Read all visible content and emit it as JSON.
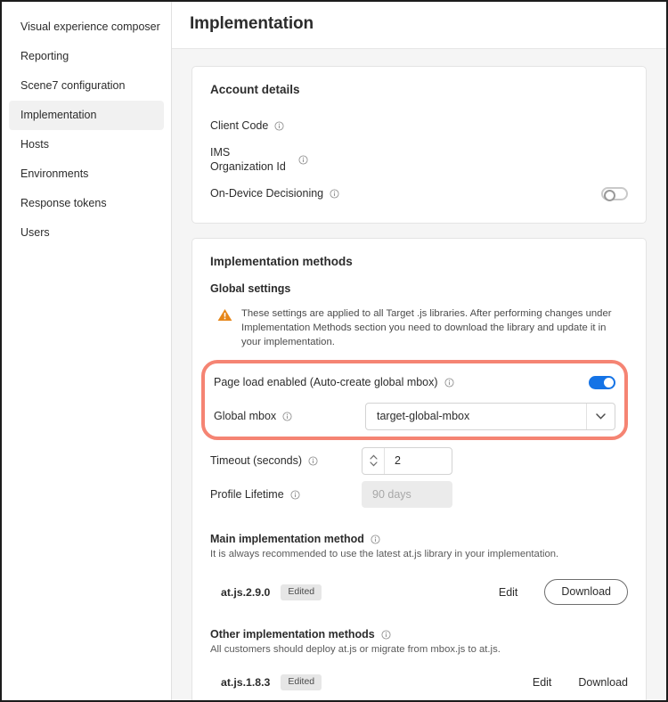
{
  "sidebar": {
    "items": [
      {
        "label": "Visual experience composer",
        "active": false
      },
      {
        "label": "Reporting",
        "active": false
      },
      {
        "label": "Scene7 configuration",
        "active": false
      },
      {
        "label": "Implementation",
        "active": true
      },
      {
        "label": "Hosts",
        "active": false
      },
      {
        "label": "Environments",
        "active": false
      },
      {
        "label": "Response tokens",
        "active": false
      },
      {
        "label": "Users",
        "active": false
      }
    ]
  },
  "header": {
    "title": "Implementation"
  },
  "account_details": {
    "title": "Account details",
    "client_code_label": "Client Code",
    "ims_org_label": "IMS Organization Id",
    "on_device_label": "On-Device Decisioning",
    "on_device_state": "off"
  },
  "implementation_methods": {
    "title": "Implementation methods",
    "global_settings_title": "Global settings",
    "warning_text": "These settings are applied to all Target .js libraries. After performing changes under Implementation Methods section you need to download the library and update it in your implementation.",
    "page_load_label": "Page load enabled (Auto-create global mbox)",
    "page_load_state": "on",
    "global_mbox_label": "Global mbox",
    "global_mbox_value": "target-global-mbox",
    "timeout_label": "Timeout (seconds)",
    "timeout_value": "2",
    "profile_lifetime_label": "Profile Lifetime",
    "profile_lifetime_value": "90 days",
    "main_method": {
      "heading": "Main implementation method",
      "description": "It is always recommended to use the latest at.js library in your implementation.",
      "library": "at.js.2.9.0",
      "badge": "Edited",
      "edit_label": "Edit",
      "download_label": "Download"
    },
    "other_methods": {
      "heading": "Other implementation methods",
      "description": "All customers should deploy at.js or migrate from mbox.js to at.js.",
      "library": "at.js.1.8.3",
      "badge": "Edited",
      "edit_label": "Edit",
      "download_label": "Download"
    }
  },
  "colors": {
    "accent_blue": "#1473e6",
    "highlight_coral": "#f58473",
    "warning_orange": "#e68619",
    "selected_nav_bg": "#f1f1f1"
  }
}
